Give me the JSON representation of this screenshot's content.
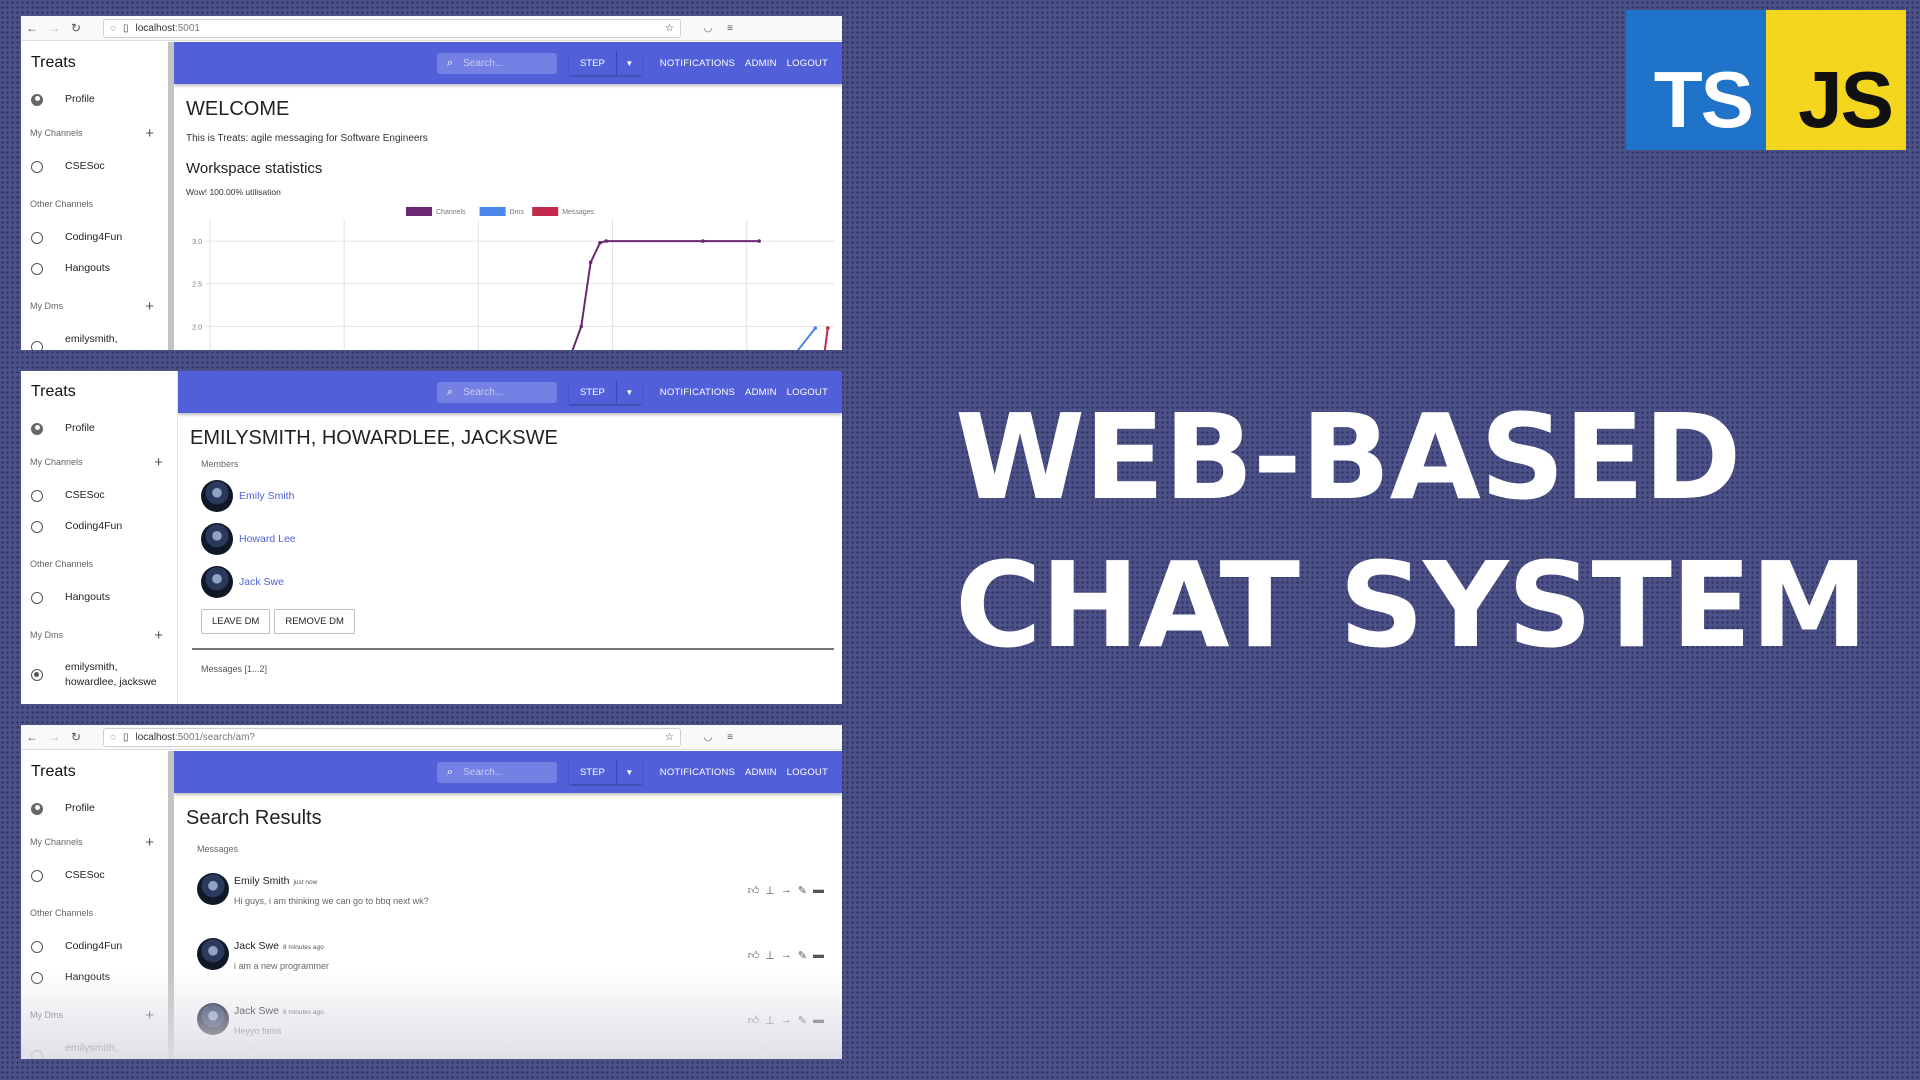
{
  "panel1": {
    "url": {
      "host": "localhost",
      "rest": ":5001"
    },
    "sidebar": {
      "title": "Treats",
      "profile": "Profile",
      "my_channels_label": "My Channels",
      "my_channels": [
        "CSESoc"
      ],
      "other_channels_label": "Other Channels",
      "other_channels": [
        "Coding4Fun",
        "Hangouts"
      ],
      "my_dms_label": "My Dms",
      "dms": [
        "emilysmith,"
      ]
    },
    "appbar": {
      "search_placeholder": "Search...",
      "step": "STEP",
      "notifications": "NOTIFICATIONS",
      "admin": "ADMIN",
      "logout": "LOGOUT"
    },
    "welcome": "WELCOME",
    "intro": "This is Treats: agile messaging for Software Engineers",
    "stats_title": "Workspace statistics",
    "utilisation": "Wow! 100.00% utilisation"
  },
  "panel2": {
    "sidebar": {
      "title": "Treats",
      "profile": "Profile",
      "my_channels_label": "My Channels",
      "my_channels": [
        "CSESoc",
        "Coding4Fun"
      ],
      "other_channels_label": "Other Channels",
      "other_channels": [
        "Hangouts"
      ],
      "my_dms_label": "My Dms",
      "dm_selected": "emilysmith, howardlee, jackswe"
    },
    "appbar": {
      "search_placeholder": "Search...",
      "step": "STEP",
      "notifications": "NOTIFICATIONS",
      "admin": "ADMIN",
      "logout": "LOGOUT"
    },
    "dm_title": "EMILYSMITH, HOWARDLEE, JACKSWE",
    "members_label": "Members",
    "members": [
      "Emily Smith",
      "Howard Lee",
      "Jack Swe"
    ],
    "leave_dm": "LEAVE DM",
    "remove_dm": "REMOVE DM",
    "messages_label": "Messages [1...2]"
  },
  "panel3": {
    "url": {
      "host": "localhost",
      "rest": ":5001/search/am?"
    },
    "sidebar": {
      "title": "Treats",
      "profile": "Profile",
      "my_channels_label": "My Channels",
      "my_channels": [
        "CSESoc"
      ],
      "other_channels_label": "Other Channels",
      "other_channels": [
        "Coding4Fun",
        "Hangouts"
      ],
      "my_dms_label": "My Dms",
      "dms": [
        "emilysmith,"
      ]
    },
    "appbar": {
      "search_placeholder": "Search...",
      "step": "STEP",
      "notifications": "NOTIFICATIONS",
      "admin": "ADMIN",
      "logout": "LOGOUT"
    },
    "title": "Search Results",
    "messages_label": "Messages",
    "results": [
      {
        "author": "Emily Smith",
        "time": "just now",
        "text": "Hi guys, i am thinking we can go to bbq next wk?"
      },
      {
        "author": "Jack Swe",
        "time": "8 minutes ago",
        "text": "i am a new programmer"
      },
      {
        "author": "Jack Swe",
        "time": "8 minutes ago",
        "text": "Heyyo fams"
      }
    ]
  },
  "logos": {
    "ts": "TS",
    "js": "JS",
    "ts_color": "#1f73c8",
    "js_color": "#f3d61d"
  },
  "headline": {
    "line1": "WEB-BASED",
    "line2": "CHAT SYSTEM"
  },
  "colors": {
    "appbar": "#5160d8",
    "background": "#4c5287"
  },
  "chart_data": {
    "type": "line",
    "legend": [
      "Channels",
      "Dms",
      "Messages"
    ],
    "colors": [
      "#6b2872",
      "#4a86e8",
      "#c2294a"
    ],
    "yticks": [
      "3.0",
      "2.5",
      "2.0"
    ],
    "ylim": [
      1.7,
      3.2
    ],
    "series": [
      {
        "name": "Channels",
        "points": [
          [
            0.575,
            1.6
          ],
          [
            0.595,
            2.0
          ],
          [
            0.61,
            2.75
          ],
          [
            0.625,
            2.98
          ],
          [
            0.635,
            3.0
          ],
          [
            0.79,
            3.0
          ],
          [
            0.88,
            3.0
          ]
        ]
      },
      {
        "name": "Dms",
        "points": [
          [
            0.94,
            1.7
          ],
          [
            0.97,
            1.98
          ]
        ]
      },
      {
        "name": "Messages",
        "points": [
          [
            0.985,
            1.7
          ],
          [
            0.99,
            1.98
          ]
        ]
      }
    ]
  }
}
